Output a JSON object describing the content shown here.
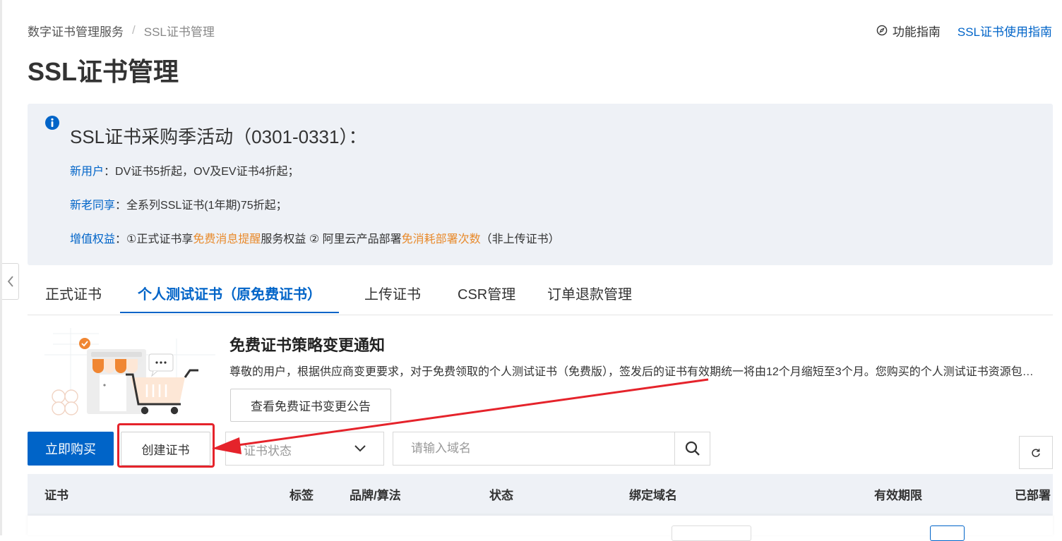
{
  "breadcrumb": {
    "items": [
      "数字证书管理服务",
      "SSL证书管理"
    ],
    "separator": "/"
  },
  "top_links": {
    "guide": "功能指南",
    "ssl_guide": "SSL证书使用指南"
  },
  "page_title": "SSL证书管理",
  "notice": {
    "title": "SSL证书采购季活动（0301-0331）：",
    "new_user": {
      "key": "新用户",
      "text": "：DV证书5折起，OV及EV证书4折起；"
    },
    "all_user": {
      "key": "新老同享",
      "text": "：全系列SSL证书(1年期)75折起；"
    },
    "value_add": {
      "key": "增值权益",
      "part1": "：①正式证书享",
      "hl1": "免费消息提醒",
      "part2": "服务权益 ② 阿里云产品部署",
      "hl2": "免消耗部署次数",
      "part3": "（非上传证书）"
    }
  },
  "tabs": [
    "正式证书",
    "个人测试证书（原免费证书）",
    "上传证书",
    "CSR管理",
    "订单退款管理"
  ],
  "active_tab": 1,
  "promo": {
    "title": "免费证书策略变更通知",
    "desc": "尊敬的用户，根据供应商变更要求，对于免费领取的个人测试证书（免费版），签发后的证书有效期统一将由12个月缩短至3个月。您购买的个人测试证书资源包及已签发的证书不受影响。",
    "button": "查看免费证书变更公告"
  },
  "toolbar": {
    "buy": "立即购买",
    "create": "创建证书",
    "status_placeholder": "证书状态",
    "search_placeholder": "请输入域名"
  },
  "table": {
    "columns": [
      "证书",
      "标签",
      "品牌/算法",
      "状态",
      "绑定域名",
      "有效期限",
      "已部署"
    ]
  },
  "colors": {
    "primary": "#0064c8",
    "highlight": "#e88a2c",
    "annotation_red": "#e5232b",
    "notice_bg": "#eef1f6"
  },
  "icons": [
    "chevron-left-icon",
    "compass-icon",
    "info-icon",
    "chevron-down-icon",
    "search-icon",
    "refresh-icon"
  ]
}
